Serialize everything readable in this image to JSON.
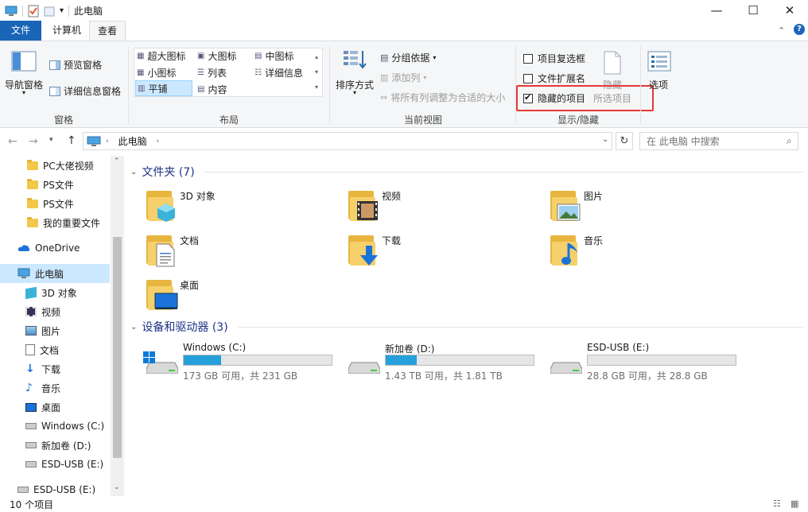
{
  "title_bar": {
    "title": "此电脑",
    "minimize": "—",
    "maximize": "☐",
    "close": "✕"
  },
  "tabs": {
    "file": "文件",
    "computer": "计算机",
    "view": "查看"
  },
  "ribbon": {
    "panes": {
      "nav_pane": "导航窗格",
      "preview_pane": "预览窗格",
      "details_pane": "详细信息窗格",
      "label": "窗格"
    },
    "layout": {
      "xlarge_icons": "超大图标",
      "large_icons": "大图标",
      "medium_icons": "中图标",
      "small_icons": "小图标",
      "list": "列表",
      "details": "详细信息",
      "tiles": "平铺",
      "content": "内容",
      "label": "布局"
    },
    "current_view": {
      "sort_by": "排序方式",
      "group_by": "分组依据",
      "add_columns": "添加列",
      "size_all_columns": "将所有列调整为合适的大小",
      "label": "当前视图"
    },
    "show_hide": {
      "item_checkboxes": "项目复选框",
      "file_extensions": "文件扩展名",
      "hidden_items": "隐藏的项目",
      "hide_selected": "隐藏",
      "selected_items": "所选项目",
      "label": "显示/隐藏",
      "item_checkboxes_checked": false,
      "file_extensions_checked": false,
      "hidden_items_checked": true
    },
    "options": "选项"
  },
  "address": {
    "path": "此电脑",
    "search_placeholder": "在 此电脑 中搜索"
  },
  "nav": {
    "items": [
      {
        "label": "PC大佬视频",
        "icon": "folder-icon"
      },
      {
        "label": "PS文件",
        "icon": "folder-icon"
      },
      {
        "label": "PS文件",
        "icon": "folder-icon"
      },
      {
        "label": "我的重要文件",
        "icon": "folder-icon"
      },
      {
        "label": "OneDrive",
        "icon": "cloud-icon"
      },
      {
        "label": "此电脑",
        "icon": "pc-icon"
      },
      {
        "label": "3D 对象",
        "icon": "3d-objects-icon"
      },
      {
        "label": "视频",
        "icon": "video-icon"
      },
      {
        "label": "图片",
        "icon": "pictures-icon"
      },
      {
        "label": "文档",
        "icon": "documents-icon"
      },
      {
        "label": "下载",
        "icon": "download-icon"
      },
      {
        "label": "音乐",
        "icon": "music-icon"
      },
      {
        "label": "桌面",
        "icon": "desktop-icon"
      },
      {
        "label": "Windows (C:)",
        "icon": "drive-icon"
      },
      {
        "label": "新加卷 (D:)",
        "icon": "drive-icon"
      },
      {
        "label": "ESD-USB (E:)",
        "icon": "drive-icon"
      },
      {
        "label": "ESD-USB (E:)",
        "icon": "drive-icon"
      }
    ]
  },
  "content": {
    "folders_header": "文件夹 (7)",
    "folders": [
      {
        "label": "3D 对象",
        "overlay": "3d"
      },
      {
        "label": "视频",
        "overlay": "video"
      },
      {
        "label": "图片",
        "overlay": "picture"
      },
      {
        "label": "文档",
        "overlay": "document"
      },
      {
        "label": "下载",
        "overlay": "download"
      },
      {
        "label": "音乐",
        "overlay": "music"
      },
      {
        "label": "桌面",
        "overlay": "desktop"
      }
    ],
    "drives_header": "设备和驱动器 (3)",
    "drives": [
      {
        "label": "Windows (C:)",
        "sub": "173 GB 可用，共 231 GB",
        "used_fraction": 0.25,
        "windows": true
      },
      {
        "label": "新加卷 (D:)",
        "sub": "1.43 TB 可用，共 1.81 TB",
        "used_fraction": 0.21,
        "windows": false
      },
      {
        "label": "ESD-USB (E:)",
        "sub": "28.8 GB 可用，共 28.8 GB",
        "used_fraction": 0.0,
        "windows": false
      }
    ]
  },
  "status": {
    "count": "10 个项目"
  },
  "colors": {
    "accent": "#1a65b8",
    "highlight_box": "#e53935",
    "selection": "#cce8ff",
    "progress": "#26a0da",
    "group_header": "#1e3287"
  }
}
